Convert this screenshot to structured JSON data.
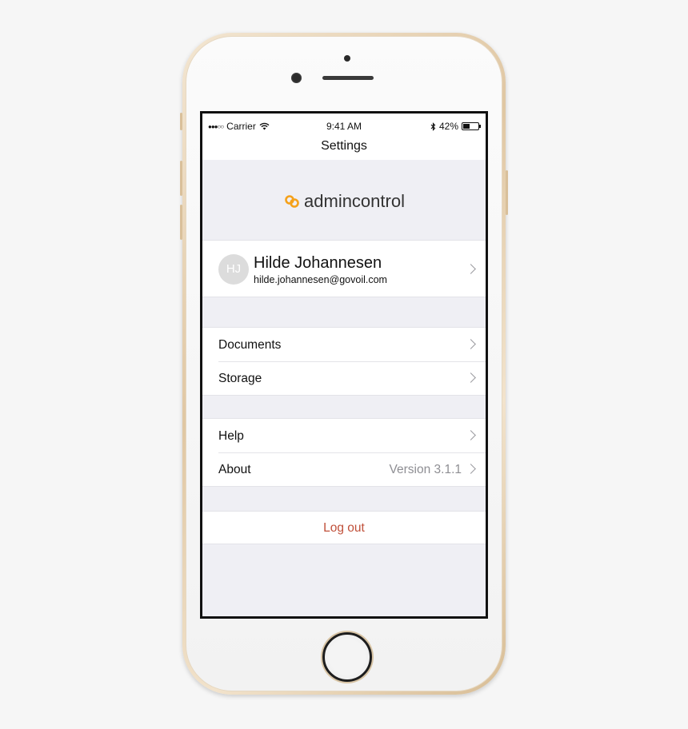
{
  "status_bar": {
    "signal": "●●●○○",
    "carrier": "Carrier",
    "time": "9:41 AM",
    "battery_text": "42%",
    "battery_level": 0.42
  },
  "nav": {
    "title": "Settings"
  },
  "logo": {
    "text": "admincontrol",
    "accent_color": "#f5a11a"
  },
  "profile": {
    "initials": "HJ",
    "name": "Hilde Johannesen",
    "email": "hilde.johannesen@govoil.com"
  },
  "group1": {
    "items": [
      {
        "label": "Documents"
      },
      {
        "label": "Storage"
      }
    ]
  },
  "group2": {
    "items": [
      {
        "label": "Help"
      },
      {
        "label": "About",
        "value": "Version 3.1.1"
      }
    ]
  },
  "logout": {
    "label": "Log out",
    "color": "#c0503a"
  },
  "icons": {
    "wifi": "wifi-icon",
    "bluetooth": "bluetooth-icon",
    "battery": "battery-icon",
    "chevron": "chevron-right-icon",
    "logo": "admincontrol-logo-icon"
  }
}
